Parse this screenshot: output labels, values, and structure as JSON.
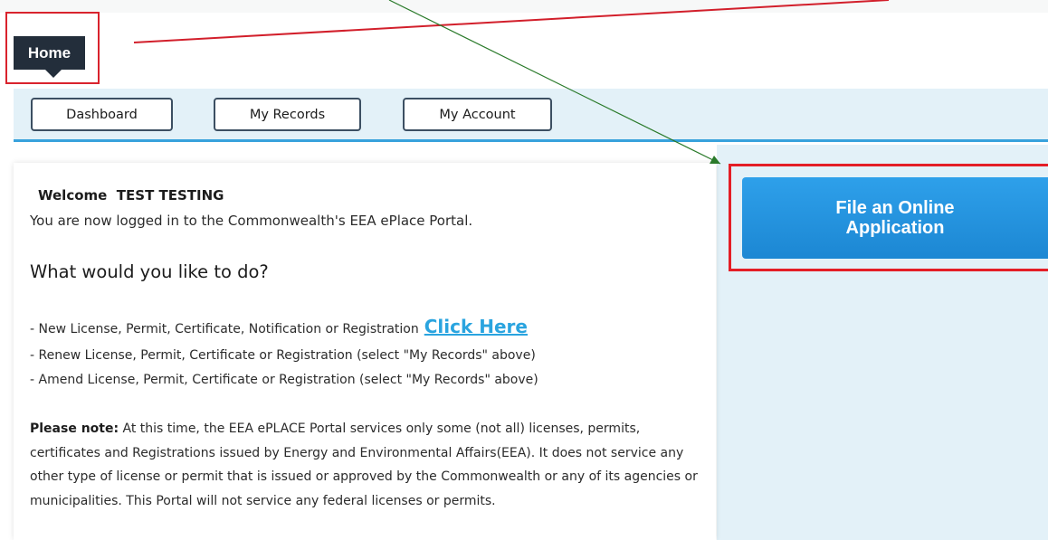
{
  "header": {
    "home_tab_label": "Home"
  },
  "nav": {
    "dashboard_label": "Dashboard",
    "my_records_label": "My Records",
    "my_account_label": "My Account"
  },
  "sidebar": {
    "file_online_label": "File an Online Application"
  },
  "main": {
    "welcome_label": "Welcome",
    "user_name": "TEST TESTING",
    "welcome_sub": "You are now logged in to the Commonwealth's EEA ePlace Portal.",
    "question": "What would you like to do?",
    "option_new": "- New License, Permit, Certificate, Notification or Registration",
    "click_here": "Click Here",
    "option_renew": "- Renew License, Permit, Certificate or Registration (select \"My Records\" above)",
    "option_amend": "- Amend License, Permit, Certificate or Registration (select \"My Records\" above)",
    "note_label": "Please note:",
    "note_text": "At this time, the EEA ePLACE Portal services only some (not all) licenses, permits, certificates and Registrations issued by Energy and Environmental Affairs(EEA). It does not service any other type of license or permit that is issued or approved by the Commonwealth or any of its agencies or municipalities. This Portal will not service any federal licenses or permits."
  },
  "colors": {
    "home_tab_bg": "#232e3b",
    "nav_band_bg": "#e3f1f8",
    "accent_blue": "#38a2dc",
    "file_button_blue": "#2196e3",
    "highlight_red": "#e41e26",
    "annotation_green": "#2a7a2a"
  }
}
